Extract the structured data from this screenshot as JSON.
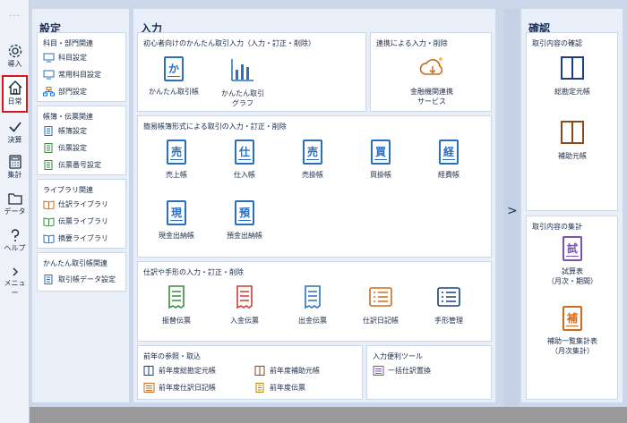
{
  "rail": {
    "dots": "···",
    "items": [
      {
        "label": "導入"
      },
      {
        "label": "日常"
      },
      {
        "label": "決算"
      },
      {
        "label": "集計"
      },
      {
        "label": "データ"
      },
      {
        "label": "ヘルプ"
      },
      {
        "label": "メニュー"
      }
    ],
    "active_color": "#d9141b"
  },
  "settings": {
    "title": "設定",
    "groups": [
      {
        "title": "科目・部門関連",
        "items": [
          "科目設定",
          "常用科目設定",
          "部門設定"
        ]
      },
      {
        "title": "帳簿・伝票関連",
        "items": [
          "帳簿設定",
          "伝票設定",
          "伝票番号設定"
        ]
      },
      {
        "title": "ライブラリ関連",
        "items": [
          "仕訳ライブラリ",
          "伝票ライブラリ",
          "摘要ライブラリ"
        ]
      },
      {
        "title": "かんたん取引帳関連",
        "items": [
          "取引帳データ設定"
        ]
      }
    ]
  },
  "input": {
    "title": "入力",
    "beginner": {
      "title": "初心者向けのかんたん取引入力（入力・訂正・削除）",
      "tiles": [
        {
          "label": "かんたん取引帳",
          "glyph": "か"
        },
        {
          "label": "かんたん取引\nグラフ"
        }
      ]
    },
    "linkage": {
      "title": "連携による入力・削除",
      "tiles": [
        {
          "label": "金融機関連携\nサービス"
        }
      ]
    },
    "simple_ledger": {
      "title": "簡易帳簿形式による取引の入力・訂正・削除",
      "tiles": [
        {
          "label": "売上帳",
          "glyph": "売"
        },
        {
          "label": "仕入帳",
          "glyph": "仕"
        },
        {
          "label": "売掛帳",
          "glyph": "売"
        },
        {
          "label": "買掛帳",
          "glyph": "買"
        },
        {
          "label": "経費帳",
          "glyph": "経"
        },
        {
          "label": "現金出納帳",
          "glyph": "現"
        },
        {
          "label": "預金出納帳",
          "glyph": "預"
        }
      ]
    },
    "journal": {
      "title": "仕訳や手形の入力・訂正・削除",
      "tiles": [
        {
          "label": "振替伝票"
        },
        {
          "label": "入金伝票"
        },
        {
          "label": "出金伝票"
        },
        {
          "label": "仕訳日記帳"
        },
        {
          "label": "手形管理"
        }
      ]
    },
    "previous_year": {
      "title": "前年の参照・取込",
      "items": [
        "前年度総勘定元帳",
        "前年度補助元帳",
        "前年度仕訳日記帳",
        "前年度伝票"
      ]
    },
    "tools": {
      "title": "入力便利ツール",
      "items": [
        "一括仕訳置換"
      ]
    }
  },
  "confirm": {
    "title": "確認",
    "contents": {
      "title": "取引内容の確認",
      "tiles": [
        {
          "label": "総勘定元帳"
        },
        {
          "label": "補助元帳"
        }
      ]
    },
    "totals": {
      "title": "取引内容の集計",
      "tiles": [
        {
          "label": "試算表\n（月次・期間）",
          "glyph": "試"
        },
        {
          "label": "補助一覧集計表\n（月次集計）",
          "glyph": "補"
        }
      ]
    }
  },
  "expand_icon": ">",
  "colors": {
    "blue": "#2a6fc0",
    "green": "#3b8a3e",
    "red": "#d23b2d",
    "orange": "#cf6a1d",
    "purple": "#7a52b5",
    "navy": "#1b3f82"
  }
}
